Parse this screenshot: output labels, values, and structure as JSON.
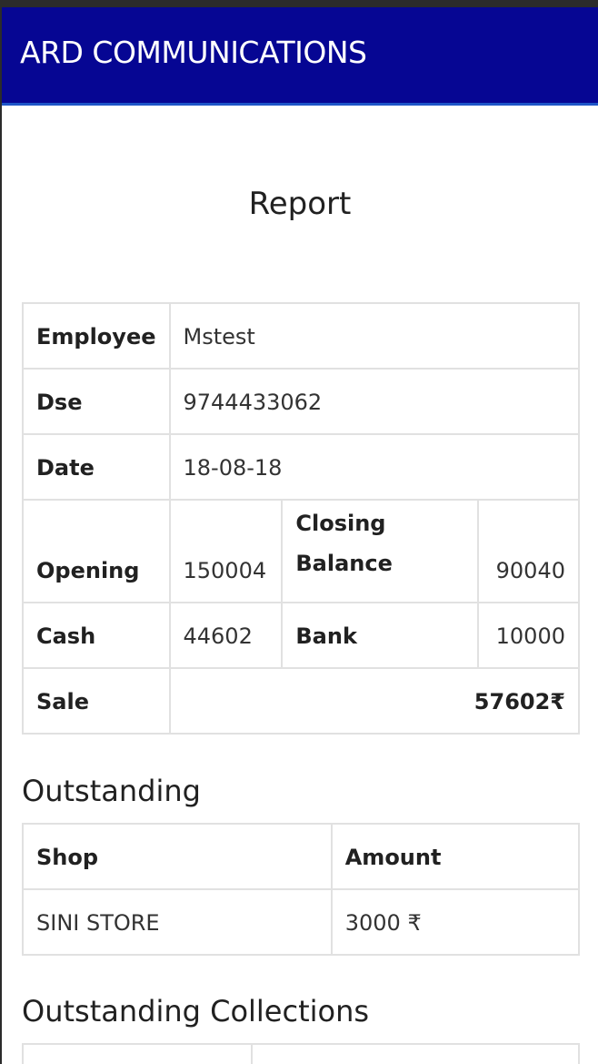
{
  "header": {
    "brand": "ARD COMMUNICATIONS"
  },
  "page": {
    "title": "Report"
  },
  "info": {
    "employee_label": "Employee",
    "employee_value": "Mstest",
    "dse_label": "Dse",
    "dse_value": "9744433062",
    "date_label": "Date",
    "date_value": "18-08-18",
    "opening_label": "Opening",
    "opening_value": "150004",
    "closing_label": "Closing Balance",
    "closing_value": "90040",
    "cash_label": "Cash",
    "cash_value": "44602",
    "bank_label": "Bank",
    "bank_value": "10000",
    "sale_label": "Sale",
    "sale_value": "57602₹"
  },
  "outstanding": {
    "heading": "Outstanding",
    "columns": [
      "Shop",
      "Amount"
    ],
    "rows": [
      {
        "shop": "SINI STORE",
        "amount": "3000 ₹"
      }
    ]
  },
  "collections": {
    "heading": "Outstanding Collections"
  }
}
